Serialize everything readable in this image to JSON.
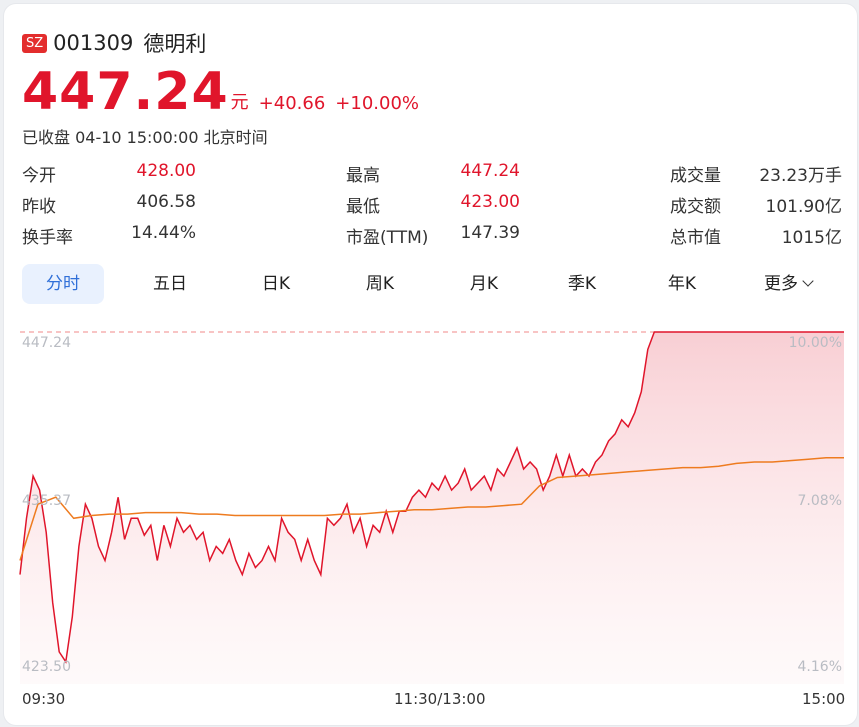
{
  "header": {
    "exchange_badge": "SZ",
    "code": "001309",
    "name": "德明利",
    "price": "447.24",
    "unit": "元",
    "change": "+40.66",
    "change_pct": "+10.00%",
    "status": "已收盘 04-10 15:00:00 北京时间"
  },
  "stats": {
    "col1": [
      {
        "label": "今开",
        "value": "428.00",
        "color": "red"
      },
      {
        "label": "昨收",
        "value": "406.58",
        "color": "normal"
      },
      {
        "label": "换手率",
        "value": "14.44%",
        "color": "normal"
      }
    ],
    "col2": [
      {
        "label": "最高",
        "value": "447.24",
        "color": "red"
      },
      {
        "label": "最低",
        "value": "423.00",
        "color": "red"
      },
      {
        "label": "市盈(TTM)",
        "value": "147.39",
        "color": "normal"
      }
    ],
    "col3": [
      {
        "label": "成交量",
        "value": "23.23万手"
      },
      {
        "label": "成交额",
        "value": "101.90亿"
      },
      {
        "label": "总市值",
        "value": "1015亿"
      }
    ]
  },
  "tabs": [
    {
      "label": "分时",
      "active": true
    },
    {
      "label": "五日"
    },
    {
      "label": "日K"
    },
    {
      "label": "周K"
    },
    {
      "label": "月K"
    },
    {
      "label": "季K"
    },
    {
      "label": "年K"
    },
    {
      "label": "更多"
    }
  ],
  "colors": {
    "up": "#e0152b",
    "avg": "#ee7b1f",
    "active_tab": "#2f6fd8"
  },
  "chart_data": {
    "type": "line",
    "y_left_ticks": [
      "447.24",
      "435.37",
      "423.50"
    ],
    "y_right_ticks": [
      "10.00%",
      "7.08%",
      "4.16%"
    ],
    "x_ticks": [
      "09:30",
      "11:30/13:00",
      "15:00"
    ],
    "ylim": [
      423.5,
      447.24
    ],
    "series": [
      {
        "key": "price",
        "values": [
          430.0,
          434.0,
          437.0,
          436.0,
          433.0,
          428.0,
          424.5,
          423.8,
          427.0,
          432.0,
          435.0,
          434.0,
          432.0,
          431.0,
          433.0,
          435.5,
          432.5,
          434.0,
          434.0,
          432.8,
          433.5,
          431.0,
          433.5,
          432.0,
          434.0,
          433.0,
          433.5,
          432.5,
          433.0,
          431.0,
          432.0,
          431.5,
          432.5,
          431.0,
          430.0,
          431.5,
          430.5,
          431.0,
          432.0,
          431.0,
          434.0,
          433.0,
          432.5,
          431.0,
          432.5,
          431.0,
          430.0,
          434.0,
          433.5,
          434.0,
          435.0,
          433.0,
          434.0,
          432.0,
          433.5,
          433.0,
          434.5,
          433.0,
          434.5,
          434.5,
          435.5,
          436.0,
          435.5,
          436.5,
          436.0,
          437.0,
          436.0,
          436.5,
          437.5,
          436.0,
          436.5,
          437.0,
          436.0,
          437.5,
          437.0,
          438.0,
          439.0,
          437.5,
          438.0,
          437.5,
          436.0,
          437.0,
          438.5,
          437.0,
          438.5,
          437.0,
          437.5,
          437.0,
          438.0,
          438.5,
          439.5,
          440.0,
          441.0,
          440.5,
          441.5,
          443.0,
          446.0,
          447.24,
          447.24,
          447.24,
          447.24,
          447.24,
          447.24,
          447.24,
          447.24,
          447.24,
          447.24,
          447.24,
          447.24,
          447.24,
          447.24,
          447.24,
          447.24,
          447.24,
          447.24,
          447.24,
          447.24,
          447.24,
          447.24,
          447.24,
          447.24,
          447.24,
          447.24,
          447.24,
          447.24,
          447.24,
          447.24
        ]
      },
      {
        "key": "avg",
        "values": [
          431.0,
          435.0,
          435.5,
          434.0,
          434.2,
          434.3,
          434.3,
          434.4,
          434.4,
          434.4,
          434.3,
          434.3,
          434.2,
          434.2,
          434.2,
          434.2,
          434.2,
          434.2,
          434.3,
          434.3,
          434.4,
          434.5,
          434.6,
          434.6,
          434.7,
          434.8,
          434.8,
          434.9,
          435.0,
          436.3,
          436.9,
          437.0,
          437.1,
          437.2,
          437.3,
          437.4,
          437.5,
          437.6,
          437.6,
          437.7,
          437.9,
          438.0,
          438.0,
          438.1,
          438.2,
          438.3,
          438.3
        ]
      }
    ]
  }
}
